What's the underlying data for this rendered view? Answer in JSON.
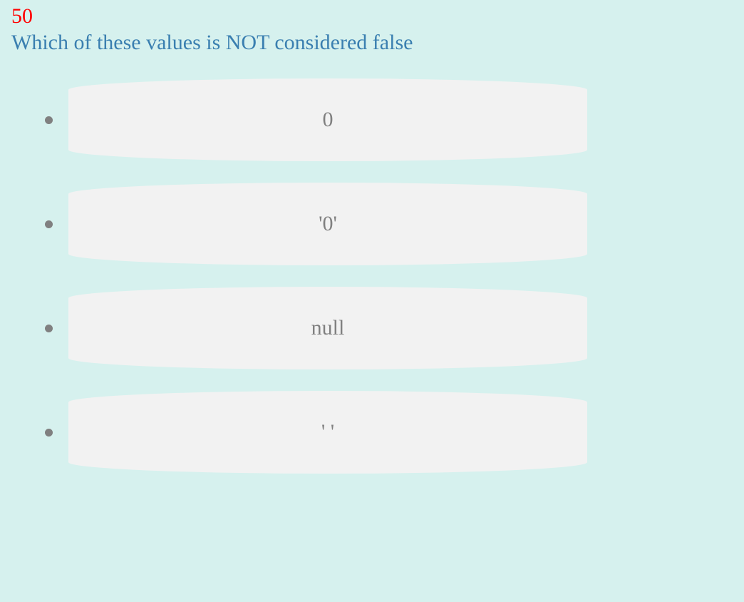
{
  "quiz": {
    "score": "50",
    "question": "Which of these values is NOT considered false",
    "options": [
      {
        "label": "0"
      },
      {
        "label": "'0'"
      },
      {
        "label": "null"
      },
      {
        "label": "' '"
      }
    ]
  },
  "colors": {
    "background": "#d6f1ee",
    "score": "#ff0000",
    "question": "#3a7fb0",
    "option_bg": "#f2f2f2",
    "option_text": "#808080"
  }
}
